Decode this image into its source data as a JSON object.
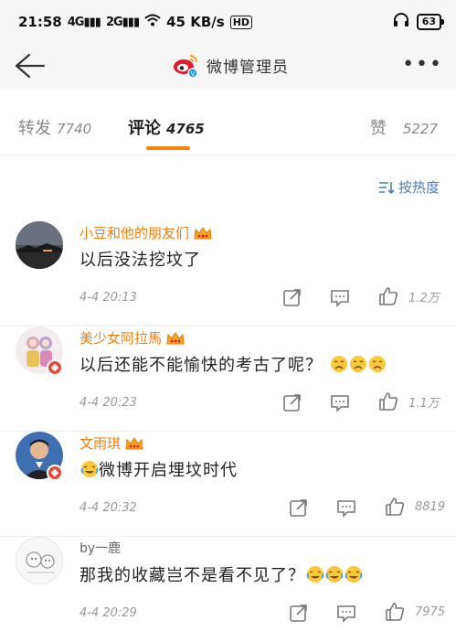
{
  "status_bar": {
    "time": "21:58",
    "sig1": "4G",
    "sig2": "2G",
    "speed": "45 KB/s",
    "hd": "HD",
    "battery": "63"
  },
  "nav": {
    "title": "微博管理员"
  },
  "tabs": {
    "repost_label": "转发",
    "repost_count": "7740",
    "comment_label": "评论",
    "comment_count": "4765",
    "like_label": "赞",
    "like_count": "5227"
  },
  "sort": {
    "label": "按热度"
  },
  "comments": [
    {
      "user": "小豆和他的朋友们",
      "text": "以后没法挖坟了",
      "time": "4-4 20:13",
      "likes": "1.2万"
    },
    {
      "user": "美少女阿拉馬",
      "text": "以后还能不能愉快的考古了呢？",
      "time": "4-4 20:23",
      "likes": "1.1万"
    },
    {
      "user": "文雨琪",
      "text": "微博开启埋坟时代",
      "time": "4-4 20:32",
      "likes": "8819"
    },
    {
      "user": "by一鹿",
      "text": "那我的收藏岂不是看不见了？",
      "time": "4-4 20:29",
      "likes": "7975"
    }
  ],
  "icons": {
    "back": "back-arrow-icon",
    "more": "more-dots-icon",
    "share": "share-icon",
    "comment": "comment-icon",
    "like": "thumbs-up-icon",
    "crown": "vip-crown-icon"
  },
  "colors": {
    "accent": "#ff8200",
    "username": "#f07f0e",
    "link": "#507daf"
  }
}
